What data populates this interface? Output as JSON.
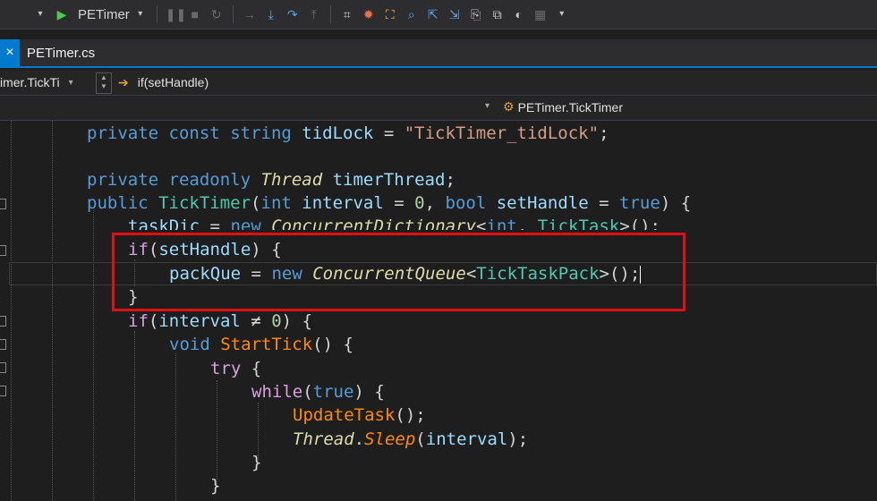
{
  "toolbar": {
    "start_label": "PETimer",
    "icons": [
      "dropdown-icon",
      "play-icon",
      "pause-icon",
      "stop-icon",
      "restart-icon",
      "step-over-icon",
      "step-into-icon",
      "step-out-icon",
      "show-next-icon",
      "hot-reload-icon",
      "diagnostics-icon",
      "breakpoint-icon",
      "find-icon",
      "nav-back-icon",
      "nav-forward-icon",
      "bookmark-icon",
      "window-icon",
      "toggle-icon",
      "hex-icon"
    ]
  },
  "tab": {
    "close": "×",
    "label": "PETimer.cs"
  },
  "nav1": {
    "member_combo": "imer.TickTi",
    "scope_label": "if(setHandle)"
  },
  "nav2": {
    "class_combo": "PETimer.TickTimer"
  },
  "code": {
    "l1": [
      "private",
      "const",
      "string",
      "tidLock",
      "=",
      "\"TickTimer_tidLock\"",
      ";"
    ],
    "l2": [
      "private",
      "readonly",
      "Thread",
      "timerThread",
      ";"
    ],
    "l3": [
      "public",
      "TickTimer",
      "(",
      "int",
      "interval",
      "=",
      "0",
      ",",
      "bool",
      "setHandle",
      "=",
      "true",
      ")",
      "{"
    ],
    "l4": [
      "taskDic",
      "=",
      "new",
      "ConcurrentDictionary",
      "<",
      "int",
      ",",
      "TickTask",
      ">();"
    ],
    "l5": [
      "if",
      "(",
      "setHandle",
      ")",
      "{"
    ],
    "l6": [
      "packQue",
      "=",
      "new",
      "ConcurrentQueue",
      "<",
      "TickTaskPack",
      ">();"
    ],
    "l7": [
      "}"
    ],
    "l8": [
      "if",
      "(",
      "interval",
      "≠",
      "0",
      ")",
      "{"
    ],
    "l9": [
      "void",
      "StartTick",
      "()",
      "{"
    ],
    "l10": [
      "try",
      "{"
    ],
    "l11": [
      "while",
      "(",
      "true",
      ")",
      "{"
    ],
    "l12": [
      "UpdateTask",
      "();"
    ],
    "l13": [
      "Thread",
      ".",
      "Sleep",
      "(",
      "interval",
      ");"
    ],
    "l14": [
      "}"
    ],
    "l15": [
      "}"
    ]
  }
}
